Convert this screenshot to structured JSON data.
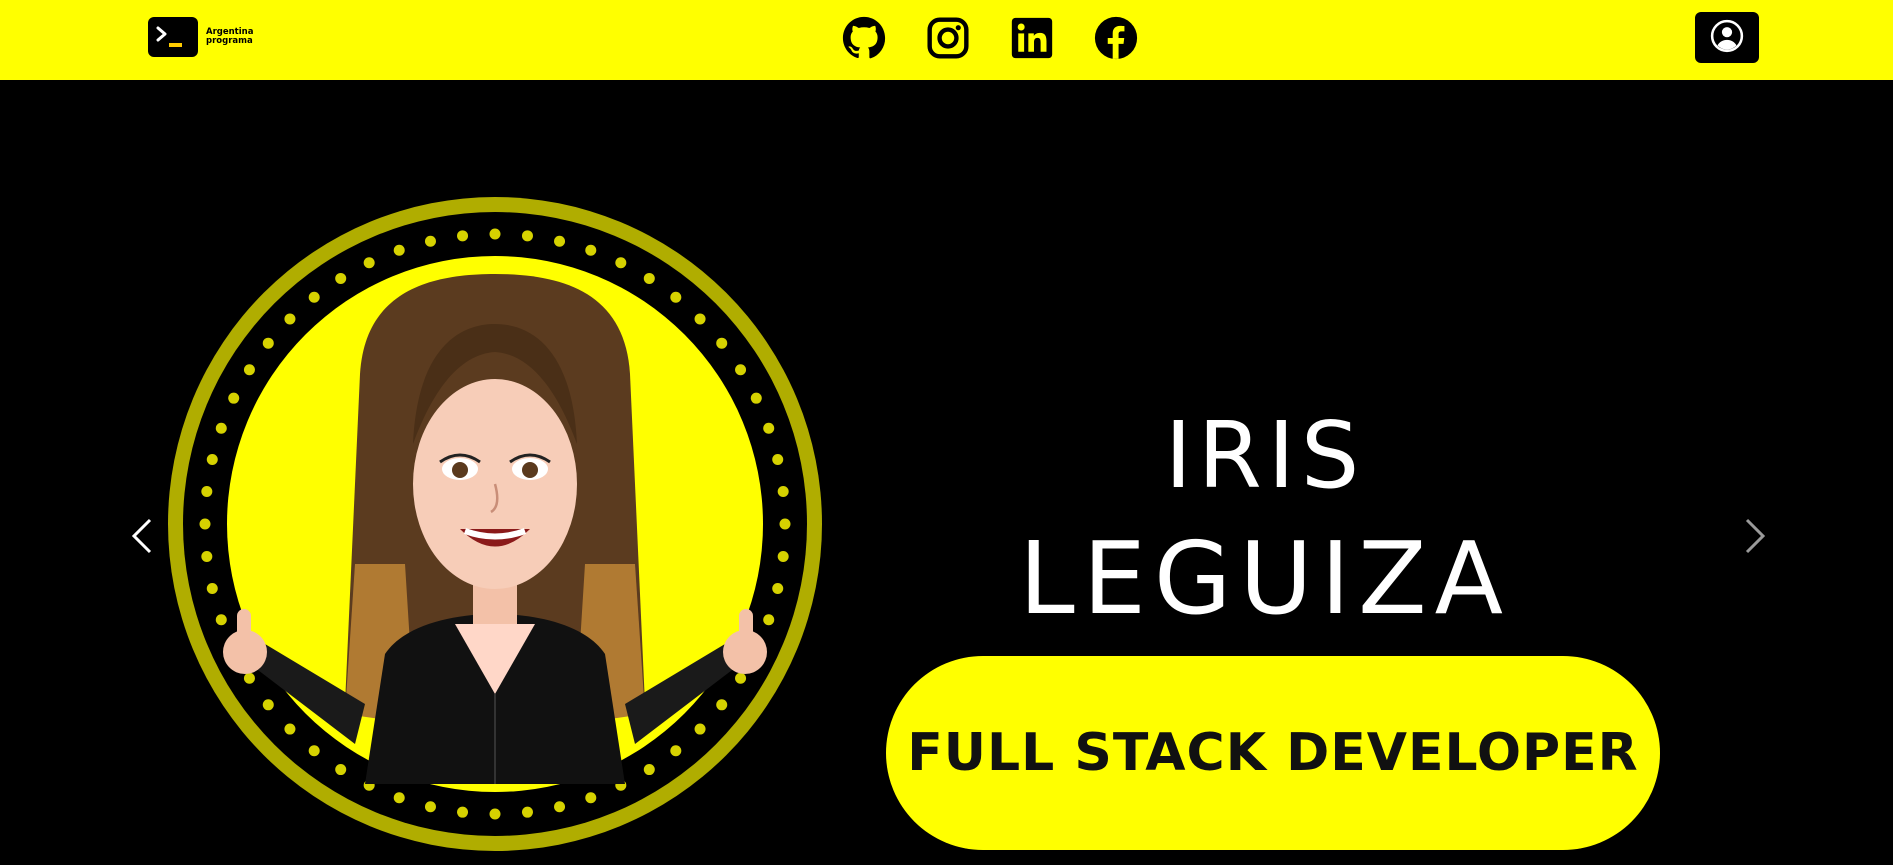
{
  "navbar": {
    "brand": {
      "icon": "terminal-prompt-icon",
      "line1": "Argentina",
      "line2": "programa"
    },
    "socials": [
      {
        "name": "github",
        "icon": "github-icon"
      },
      {
        "name": "instagram",
        "icon": "instagram-icon"
      },
      {
        "name": "linkedin",
        "icon": "linkedin-icon"
      },
      {
        "name": "facebook",
        "icon": "facebook-icon"
      }
    ],
    "login_icon": "user-circle-icon"
  },
  "hero": {
    "first_name": "IRIS",
    "last_name": "LEGUIZA",
    "role": "FULL STACK DEVELOPER",
    "prev_icon": "chevron-left-icon",
    "next_icon": "chevron-right-icon"
  },
  "colors": {
    "accent": "#ffff00",
    "background": "#000000",
    "text": "#ffffff"
  }
}
